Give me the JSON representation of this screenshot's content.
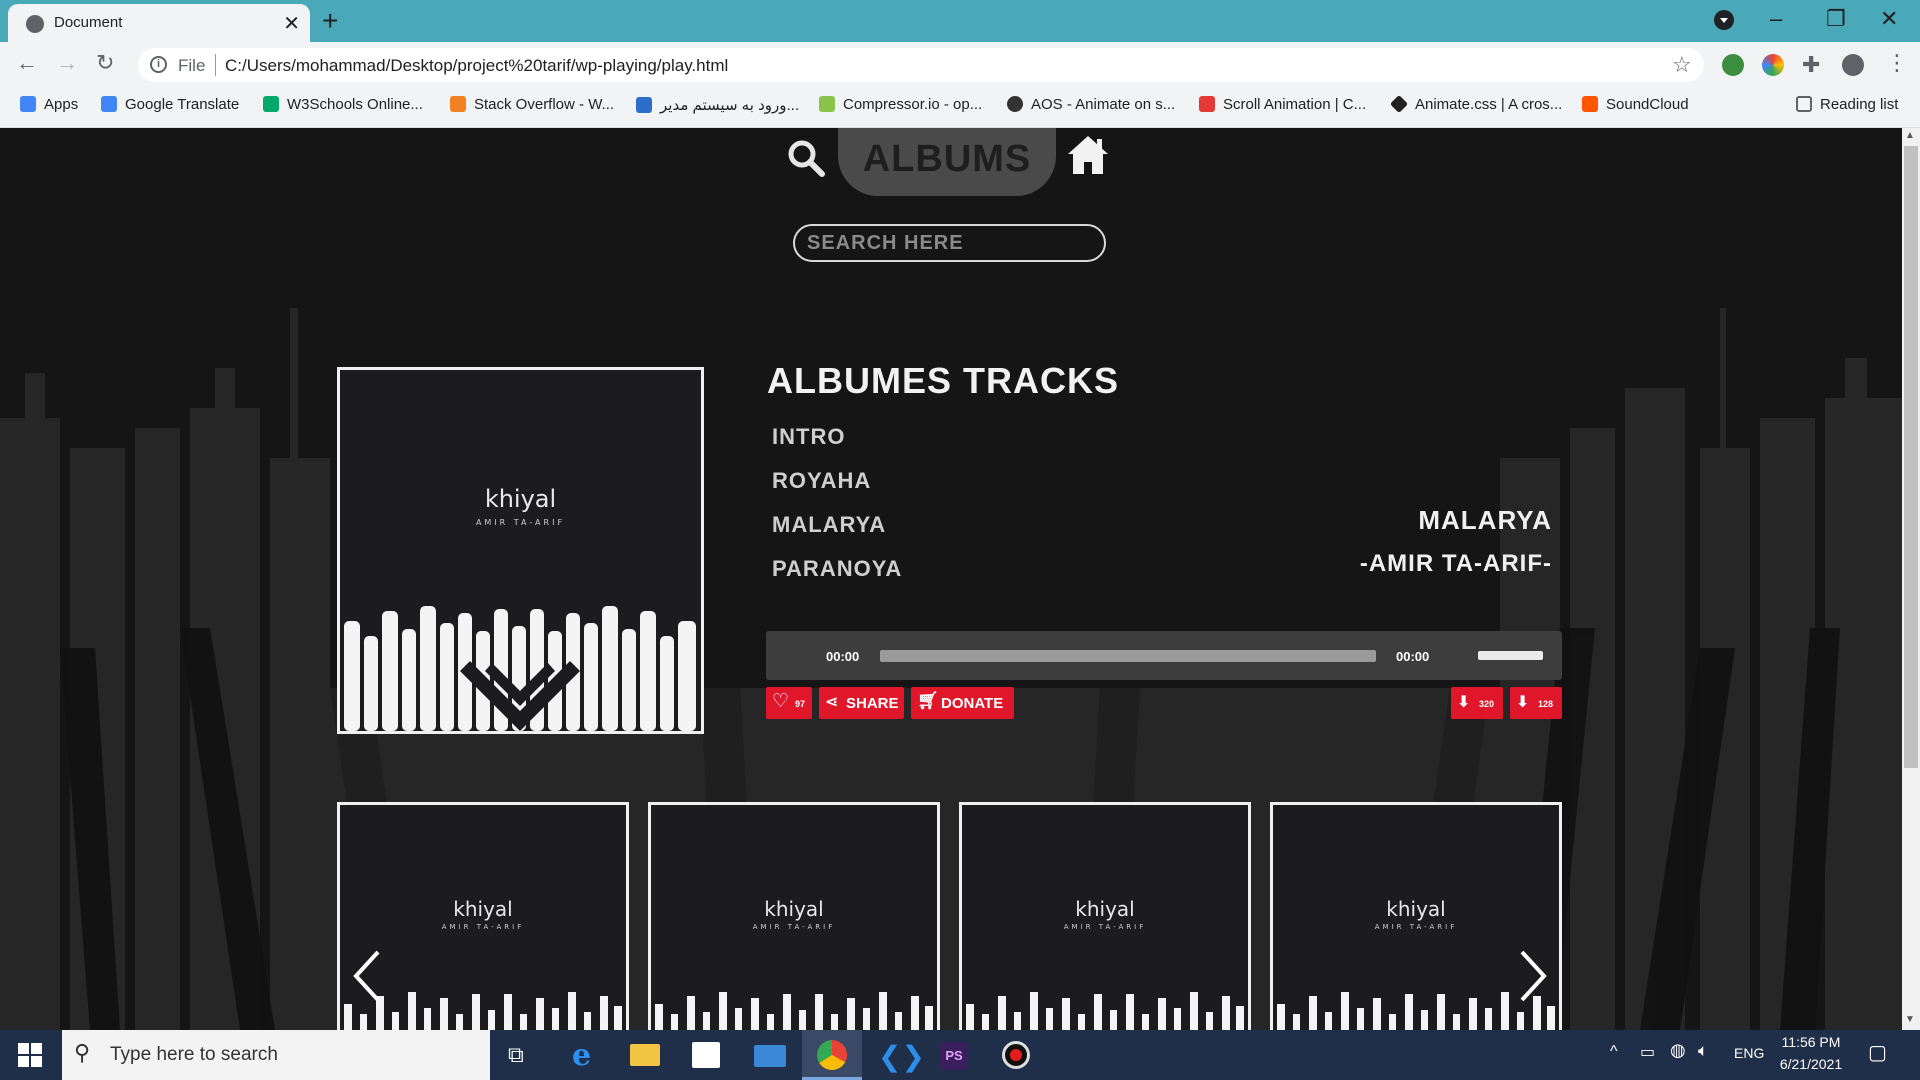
{
  "browser": {
    "tab_title": "Document",
    "new_tab_icon": "plus-icon",
    "url_scheme_label": "File",
    "url": "C:/Users/mohammad/Desktop/project%20tarif/wp-playing/play.html",
    "bookmarks": [
      {
        "label": "Apps",
        "icon": "apps-grid-icon",
        "color": "#4285f4"
      },
      {
        "label": "Google Translate",
        "icon": "google-translate-icon",
        "color": "#4285f4"
      },
      {
        "label": "W3Schools Online...",
        "icon": "w3schools-icon",
        "color": "#04aa6d"
      },
      {
        "label": "Stack Overflow - W...",
        "icon": "stackoverflow-icon",
        "color": "#f48024"
      },
      {
        "label": "ورود به سیستم مدیر...",
        "icon": "wordpress-icon",
        "color": "#2c6ec9"
      },
      {
        "label": "Compressor.io - op...",
        "icon": "compressor-icon",
        "color": "#8bc34a"
      },
      {
        "label": "AOS - Animate on s...",
        "icon": "globe-icon",
        "color": "#333333"
      },
      {
        "label": "Scroll Animation | C...",
        "icon": "asterisk-icon",
        "color": "#e53935"
      },
      {
        "label": "Animate.css | A cros...",
        "icon": "diamond-icon",
        "color": "#222222"
      },
      {
        "label": "SoundCloud",
        "icon": "soundcloud-icon",
        "color": "#ff5500"
      }
    ],
    "reading_list": "Reading list"
  },
  "nav": {
    "albums_label": "ALBUMS",
    "search_placeholder": "SEARCH HERE"
  },
  "album": {
    "name": "khiyal",
    "artist": "AMIR TA-ARIF"
  },
  "tracks": {
    "title": "ALBUMES TRACKS",
    "items": [
      "INTRO",
      "ROYAHA",
      "MALARYA",
      "PARANOYA"
    ]
  },
  "now_playing": {
    "title": "MALARYA",
    "artist": "-AMIR TA-ARIF-"
  },
  "player": {
    "current_time": "00:00",
    "duration": "00:00",
    "progress": 0
  },
  "actions": {
    "likes": "97",
    "share": "SHARE",
    "donate": "DONATE",
    "download_320": "320",
    "download_128": "128"
  },
  "carousel": [
    {
      "name": "khiyal",
      "artist": "AMIR TA-ARIF"
    },
    {
      "name": "khiyal",
      "artist": "AMIR TA-ARIF"
    },
    {
      "name": "khiyal",
      "artist": "AMIR TA-ARIF"
    },
    {
      "name": "khiyal",
      "artist": "AMIR TA-ARIF"
    }
  ],
  "taskbar": {
    "search_placeholder": "Type here to search",
    "language": "ENG",
    "time": "11:56 PM",
    "date": "6/21/2021"
  },
  "colors": {
    "accent_red": "#e0162b",
    "tabstrip": "#4aa9b8",
    "page_bg": "#151515"
  }
}
